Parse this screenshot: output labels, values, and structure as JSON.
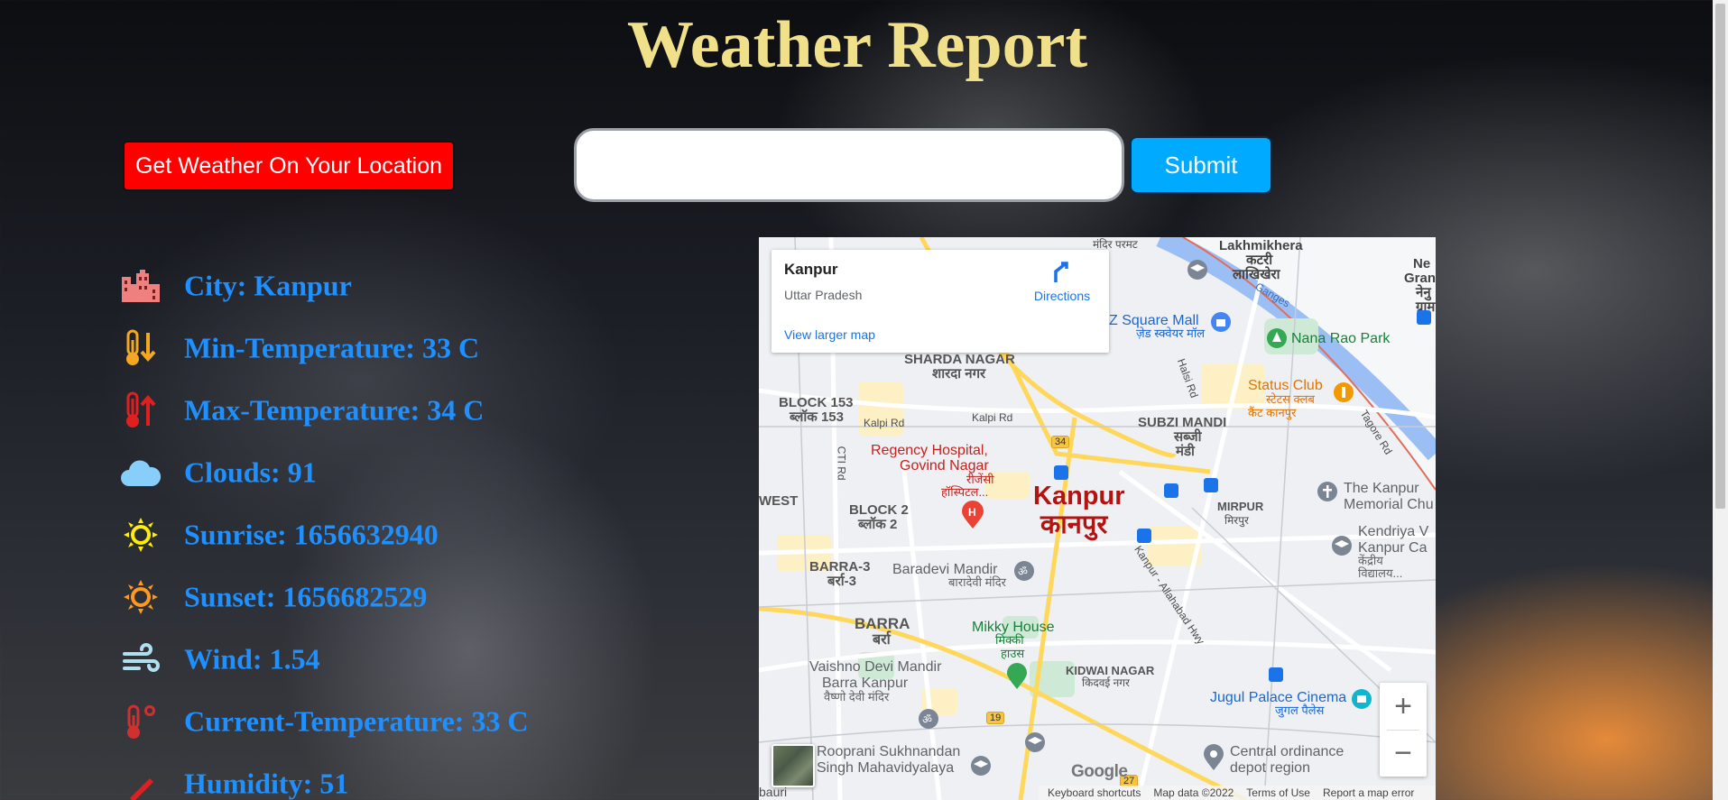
{
  "page": {
    "title": "Weather Report"
  },
  "controls": {
    "location_button": "Get Weather On Your Location",
    "search_value": "",
    "search_placeholder": "",
    "submit_label": "Submit"
  },
  "weather": [
    {
      "icon": "city-icon",
      "color": "#f08080",
      "text": "City: Kanpur"
    },
    {
      "icon": "min-temperature-icon",
      "color": "#f5a623",
      "text": "Min-Temperature: 33 C"
    },
    {
      "icon": "max-temperature-icon",
      "color": "#e02020",
      "text": "Max-Temperature: 34 C"
    },
    {
      "icon": "cloud-icon",
      "color": "#87cefa",
      "text": "Clouds: 91"
    },
    {
      "icon": "sunrise-icon",
      "color": "#ffee00",
      "text": "Sunrise: 1656632940"
    },
    {
      "icon": "sunset-icon",
      "color": "#ff9a1f",
      "text": "Sunset: 1656682529"
    },
    {
      "icon": "wind-icon",
      "color": "#b0e0f0",
      "text": "Wind: 1.54"
    },
    {
      "icon": "current-temperature-icon",
      "color": "#d03030",
      "text": "Current-Temperature: 33 C"
    },
    {
      "icon": "humidity-icon",
      "color": "#e02020",
      "text": "Humidity: 51"
    }
  ],
  "map": {
    "card": {
      "name": "Kanpur",
      "state": "Uttar Pradesh",
      "directions": "Directions",
      "larger_map": "View larger map"
    },
    "city_label": "Kanpur",
    "city_label_local": "कानपुर",
    "labels": {
      "mandir_parmat": "मंदिर परमट",
      "lakhmikhera": "Lakhmikhera",
      "lakhmikhera_local": "कटरी",
      "lakhmikhera_local2": "लाखिखेरा",
      "new_gran": "Ne",
      "new_gran2": "Gran",
      "new_gran3": "नेनु",
      "new_gran4": "ग्राम",
      "ganges": "Ganges",
      "z_square": "Z Square Mall",
      "z_square_local": "ज़ेड स्क्वेयर मॉल",
      "nana_rao": "Nana Rao Park",
      "sharda_nagar": "SHARDA NAGAR",
      "sharda_nagar_local": "शारदा नगर",
      "halsi_rd": "Halsi Rd",
      "status_club": "Status Club",
      "status_club_local": "स्टेटस क्लब",
      "status_club_local2": "कैंट कानपुर",
      "block153": "BLOCK 153",
      "block153_local": "ब्लॉक 153",
      "kalpi_rd": "Kalpi Rd",
      "kalpi_rd2": "Kalpi Rd",
      "subzi_mandi": "SUBZI MANDI",
      "subzi_mandi_local": "सब्जी",
      "subzi_mandi_local2": "मंडी",
      "tagore_rd": "Tagore Rd",
      "cti_rd": "CTI Rd",
      "regency": "Regency Hospital,",
      "regency2": "Govind Nagar",
      "regency_local": "रीजेंसी",
      "regency_local2": "हॉस्पिटल...",
      "route34": "34",
      "west": "WEST",
      "block2": "BLOCK 2",
      "block2_local": "ब्लॉक 2",
      "mirpur": "MIRPUR",
      "mirpur_local": "मिरपुर",
      "kanpur_memorial": "The Kanpur",
      "kanpur_memorial2": "Memorial Chu",
      "kanpur_allahabad": "Kanpur - Allahabad Hwy",
      "kendriya": "Kendriya V",
      "kendriya2": "Kanpur Ca",
      "kendriya3": "केंद्रीय",
      "kendriya4": "विद्यालय...",
      "barra3": "BARRA-3",
      "barra3_local": "बर्रा-3",
      "baradevi": "Baradevi Mandir",
      "baradevi_local": "बारादेवी मंदिर",
      "barra": "BARRA",
      "barra_local": "बर्रा",
      "mikky": "Mikky House",
      "mikky_local": "मिक्की",
      "mikky_local2": "हाउस",
      "vaishno": "Vaishno Devi Mandir",
      "vaishno2": "Barra Kanpur",
      "vaishno_local": "वैष्णो देवी मंदिर",
      "kidwai": "KIDWAI NAGAR",
      "kidwai_local": "किदवई नगर",
      "jugul": "Jugul Palace Cinema",
      "jugul_local": "जुगल पैलेस",
      "route19": "19",
      "rooprani": "Rooprani Sukhnandan",
      "rooprani2": "Singh Mahavidyalaya",
      "central_ord": "Central ordinance",
      "central_ord2": "depot region",
      "route27": "27",
      "bottom_left": "bauri"
    },
    "google": "Google",
    "footer": [
      "Keyboard shortcuts",
      "Map data ©2022",
      "Terms of Use",
      "Report a map error"
    ],
    "zoom_in": "+",
    "zoom_out": "−"
  }
}
